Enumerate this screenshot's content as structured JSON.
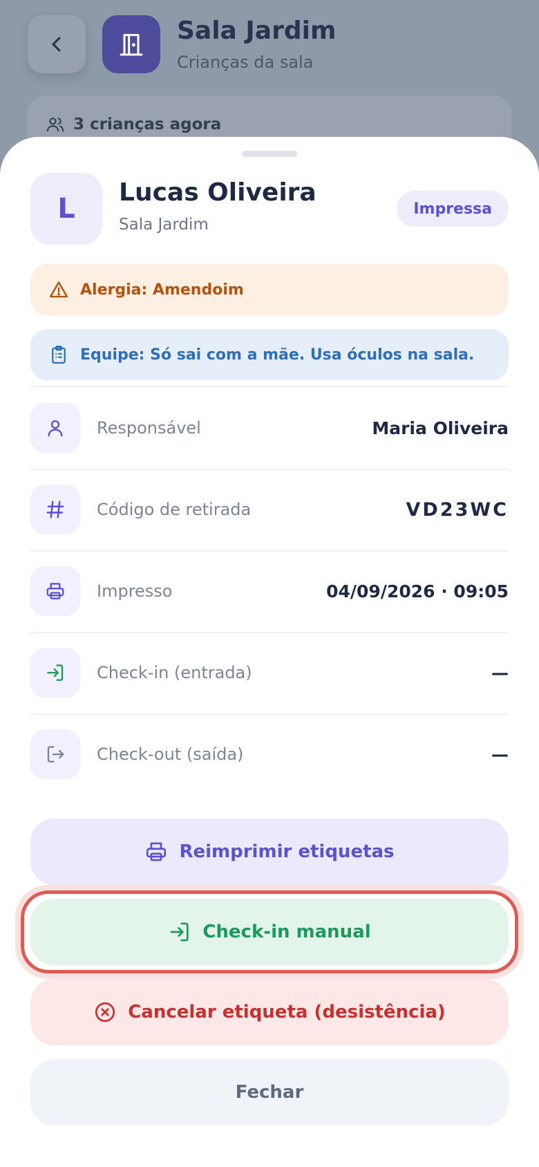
{
  "background": {
    "room_title": "Sala Jardim",
    "room_subtitle": "Crianças da sala",
    "children_count": "3 crianças agora"
  },
  "sheet": {
    "avatar_initial": "L",
    "child_name": "Lucas Oliveira",
    "child_room": "Sala Jardim",
    "status_badge": "Impressa",
    "allergy_alert": "Alergia: Amendoim",
    "team_note": "Equipe: Só sai com a mãe. Usa óculos na sala.",
    "details": [
      {
        "label": "Responsável",
        "value": "Maria Oliveira",
        "icon": "person-icon"
      },
      {
        "label": "Código de retirada",
        "value": "VD23WC",
        "icon": "hash-icon"
      },
      {
        "label": "Impresso",
        "value": "04/09/2026 · 09:05",
        "icon": "printer-icon"
      },
      {
        "label": "Check-in (entrada)",
        "value": "—",
        "icon": "login-icon"
      },
      {
        "label": "Check-out (saída)",
        "value": "—",
        "icon": "logout-icon"
      }
    ],
    "buttons": {
      "reprint": "Reimprimir etiquetas",
      "checkin": "Check-in manual",
      "cancel": "Cancelar etiqueta (desistência)",
      "close": "Fechar"
    }
  },
  "colors": {
    "accent": "#5a52cf",
    "success": "#1c9a5c",
    "danger": "#c82f2f",
    "warning": "#b55210",
    "info": "#2f6fb8"
  }
}
